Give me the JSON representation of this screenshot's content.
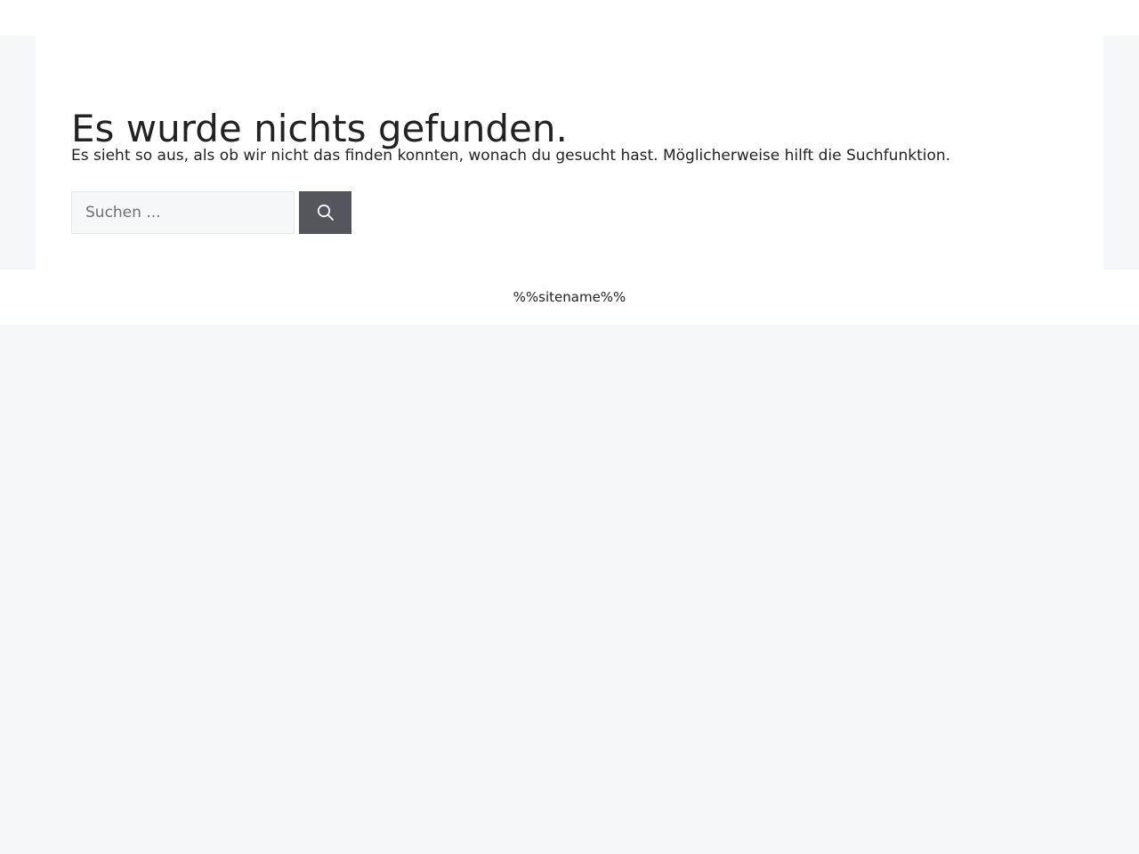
{
  "page": {
    "title": "Es wurde nichts gefunden.",
    "message": "Es sieht so aus, als ob wir nicht das finden konnten, wonach du gesucht hast. Möglicherweise hilft die Suchfunktion."
  },
  "search": {
    "placeholder": "Suchen ...",
    "value": "",
    "button_icon": "search-icon"
  },
  "footer": {
    "site_name": "%%sitename%%"
  },
  "colors": {
    "page_background": "#f6f7f8",
    "content_background": "#ffffff",
    "text": "#222222",
    "button_background": "#55555e",
    "button_icon": "#ffffff",
    "input_background": "#f6f7f8"
  }
}
